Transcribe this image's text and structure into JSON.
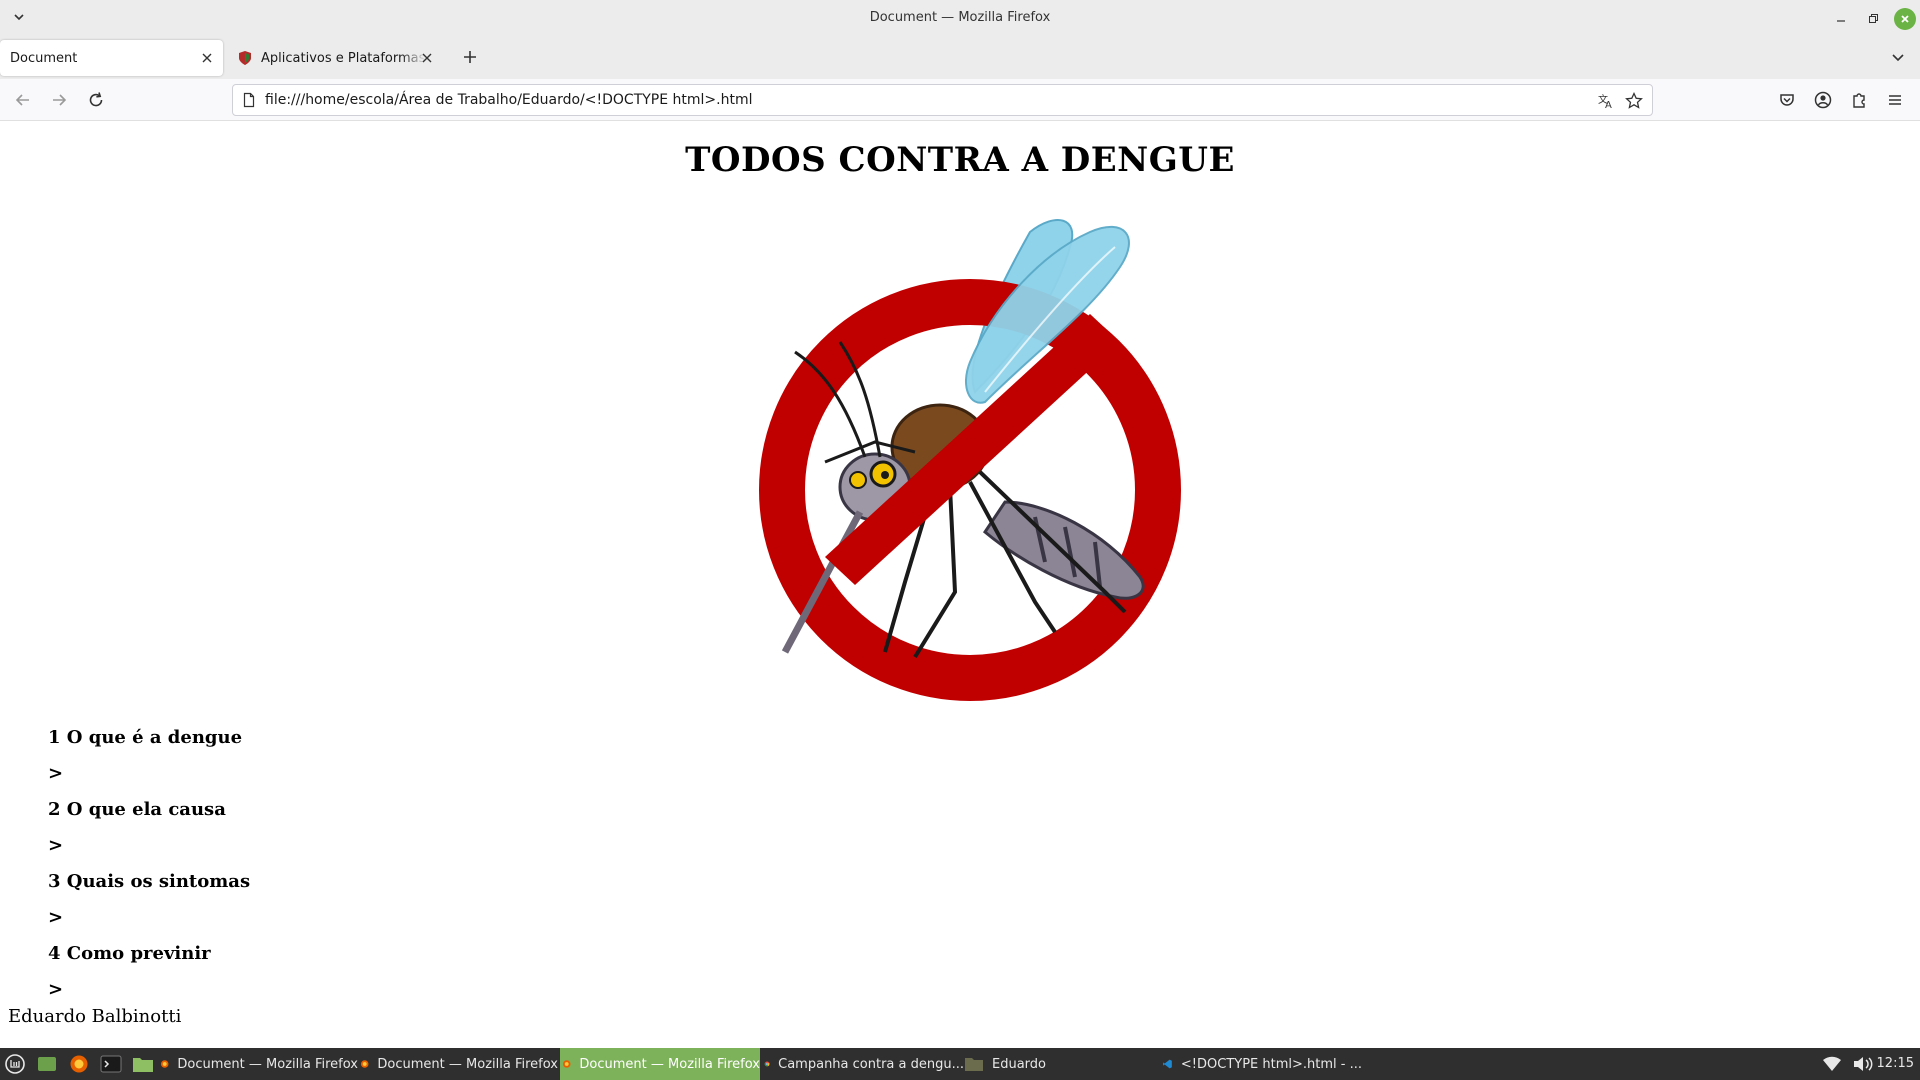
{
  "window": {
    "title": "Document — Mozilla Firefox"
  },
  "tabs": [
    {
      "label": "Document",
      "active": true
    },
    {
      "label": "Aplicativos e Plataformas E",
      "active": false
    }
  ],
  "navbar": {
    "url": "file:///home/escola/Área de Trabalho/Eduardo/<!DOCTYPE html>.html"
  },
  "page": {
    "heading": "TODOS CONTRA A DENGUE",
    "sections": [
      {
        "title": "1 O que é a dengue",
        "arrow": ">"
      },
      {
        "title": "2 O que ela causa",
        "arrow": ">"
      },
      {
        "title": "3 Quais os sintomas",
        "arrow": ">"
      },
      {
        "title": "4 Como previnir",
        "arrow": ">"
      }
    ],
    "author": "Eduardo Balbinotti",
    "image": {
      "icon": "no-mosquito-sign",
      "sign_color": "#c00000",
      "wing_color": "#8fd3ea"
    }
  },
  "taskbar": {
    "items": [
      {
        "label": "Document — Mozilla Firefox",
        "active": false
      },
      {
        "label": "Document — Mozilla Firefox",
        "active": false
      },
      {
        "label": "Document — Mozilla Firefox",
        "active": true
      },
      {
        "label": "Campanha contra a dengu...",
        "active": false
      },
      {
        "label": "Eduardo",
        "active": false
      },
      {
        "label": "<!DOCTYPE html>.html - ...",
        "active": false
      }
    ],
    "clock": "12:15",
    "accent": "#7db25a"
  }
}
